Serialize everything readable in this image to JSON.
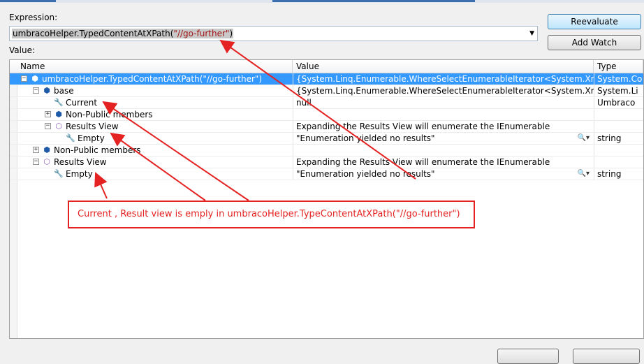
{
  "dialog": {
    "expression_label": "Expression:",
    "expression_value_prefix": "umbracoHelper.TypedContentAtXPath(",
    "expression_value_string": "\"//go-further\"",
    "expression_value_suffix": ")",
    "value_label": "Value:",
    "reevaluate_label": "Reevaluate",
    "add_watch_label": "Add Watch"
  },
  "grid": {
    "columns": [
      "Name",
      "Value",
      "Type"
    ],
    "rows": [
      {
        "name": "umbracoHelper.TypedContentAtXPath(\"//go-further\")",
        "value": "{System.Linq.Enumerable.WhereSelectEnumerableIterator<System.Xml.XmlNode",
        "type": "System.Co",
        "expander": "−",
        "icon": "cube-icon",
        "glyph": "⬢",
        "level": 0,
        "selected": true
      },
      {
        "name": "base",
        "value": "{System.Linq.Enumerable.WhereSelectEnumerableIterator<System.Xml.XmlNode",
        "type": "System.Li",
        "expander": "−",
        "icon": "cube-icon",
        "glyph": "⬢",
        "level": 1
      },
      {
        "name": "Current",
        "value": "null",
        "type": "Umbraco",
        "expander": "",
        "icon": "wrench-icon",
        "glyph": "🔧",
        "level": 2
      },
      {
        "name": "Non-Public members",
        "value": "",
        "type": "",
        "expander": "+",
        "icon": "cube-icon",
        "glyph": "⬢",
        "level": 2
      },
      {
        "name": "Results View",
        "value": "Expanding the Results View will enumerate the IEnumerable",
        "type": "",
        "expander": "−",
        "icon": "results-view-icon",
        "glyph": "⬡",
        "level": 2
      },
      {
        "name": "Empty",
        "value": "\"Enumeration yielded no results\"",
        "type": "string",
        "expander": "",
        "icon": "wrench-icon",
        "glyph": "🔧",
        "level": 3,
        "magnifier": true
      },
      {
        "name": "Non-Public members",
        "value": "",
        "type": "",
        "expander": "+",
        "icon": "cube-icon",
        "glyph": "⬢",
        "level": 1
      },
      {
        "name": "Results View",
        "value": "Expanding the Results View will enumerate the IEnumerable",
        "type": "",
        "expander": "−",
        "icon": "results-view-icon",
        "glyph": "⬡",
        "level": 1
      },
      {
        "name": "Empty",
        "value": "\"Enumeration yielded no results\"",
        "type": "string",
        "expander": "",
        "icon": "wrench-icon",
        "glyph": "🔧",
        "level": 2,
        "magnifier": true
      }
    ]
  },
  "annotation": {
    "text": "Current  , Result view is emply in umbracoHelper.TypeContentAtXPath(\"//go-further\")",
    "color": "#e52222"
  },
  "magnifier_glyph": "🔍▾"
}
